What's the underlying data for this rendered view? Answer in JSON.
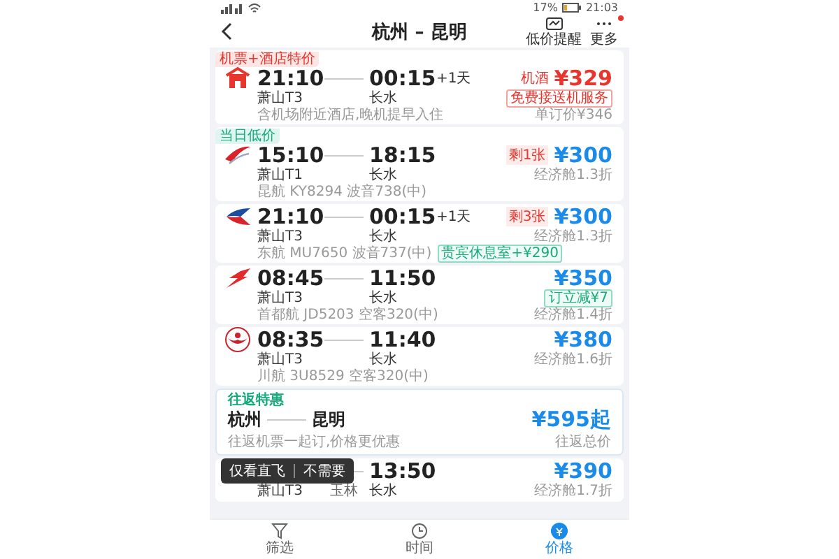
{
  "status_bar": {
    "battery": "17%",
    "time": "21:03"
  },
  "header": {
    "title": "杭州 – 昆明",
    "actions": [
      {
        "label": "低价提醒",
        "kind": "alert"
      },
      {
        "label": "更多",
        "kind": "more"
      }
    ]
  },
  "flights": [
    {
      "kind": "package",
      "tag": "机票+酒店特价",
      "depart": "21:10",
      "arrive": "00:15",
      "next_day": "+1天",
      "from": "萧山T3",
      "to": "长水",
      "price_prefix": "机酒",
      "price": "¥329",
      "line2_right": {
        "text": "免费接送机服务",
        "kind": "badge-red"
      },
      "info": "含机场附近酒店,晚机提早入住",
      "line3_right": "单订价¥346"
    },
    {
      "kind": "flight",
      "tag": "当日低价",
      "depart": "15:10",
      "arrive": "18:15",
      "from": "萧山T1",
      "to": "长水",
      "seats": "剩1张",
      "price": "¥300",
      "line2_right": {
        "text": "经济舱1.3折",
        "kind": "plain"
      },
      "info": "昆航 KY8294  波音738(中)"
    },
    {
      "kind": "flight",
      "depart": "21:10",
      "arrive": "00:15",
      "next_day": "+1天",
      "from": "萧山T3",
      "to": "长水",
      "seats": "剩3张",
      "price": "¥300",
      "line2_right": {
        "text": "经济舱1.3折",
        "kind": "plain"
      },
      "info": "东航 MU7650  波音737(中)",
      "info_badge": "贵宾休息室+¥290"
    },
    {
      "kind": "flight",
      "depart": "08:45",
      "arrive": "11:50",
      "from": "萧山T3",
      "to": "长水",
      "price": "¥350",
      "line2_right": {
        "text": "订立减¥7",
        "kind": "badge-green"
      },
      "info": "首都航 JD5203  空客320(中)",
      "line3_right": "经济舱1.4折"
    },
    {
      "kind": "flight",
      "depart": "08:35",
      "arrive": "11:40",
      "from": "萧山T3",
      "to": "长水",
      "price": "¥380",
      "line2_right": {
        "text": "经济舱1.6折",
        "kind": "plain"
      },
      "info": "川航 3U8529  空客320(中)"
    }
  ],
  "round_trip": {
    "tag": "往返特惠",
    "from": "杭州",
    "to": "昆明",
    "note": "往返机票一起订,价格更优惠",
    "price": "¥595起",
    "price_label": "往返总价"
  },
  "partial_flight": {
    "arrive": "13:50",
    "from": "萧山T3",
    "stop": "玉林",
    "to": "长水",
    "price": "¥390",
    "fare": "经济舱1.7折"
  },
  "tooltip": {
    "text": "仅看直飞",
    "dismiss": "不需要"
  },
  "bottom_nav": [
    {
      "label": "筛选",
      "kind": "filter",
      "selected": false
    },
    {
      "label": "时间",
      "kind": "time",
      "selected": false
    },
    {
      "label": "价格",
      "kind": "price",
      "selected": true
    }
  ]
}
